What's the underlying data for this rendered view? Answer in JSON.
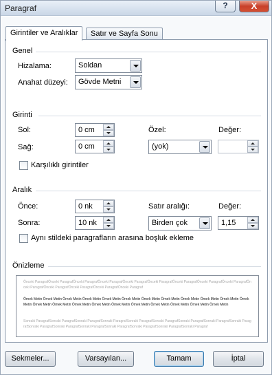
{
  "window": {
    "title": "Paragraf",
    "help_symbol": "?",
    "close_symbol": "X"
  },
  "tabs": [
    {
      "label": "Girintiler ve Aralıklar",
      "active": true
    },
    {
      "label": "Satır ve Sayfa Sonu",
      "active": false
    }
  ],
  "general": {
    "title": "Genel",
    "alignment_label": "Hizalama:",
    "alignment_value": "Soldan",
    "outline_label": "Anahat düzeyi:",
    "outline_value": "Gövde Metni"
  },
  "indent": {
    "title": "Girinti",
    "left_label": "Sol:",
    "left_value": "0 cm",
    "right_label": "Sağ:",
    "right_value": "0 cm",
    "special_label": "Özel:",
    "special_value": "(yok)",
    "by_label": "Değer:",
    "by_value": "",
    "mirror_label": "Karşılıklı girintiler",
    "mirror_checked": false
  },
  "spacing": {
    "title": "Aralık",
    "before_label": "Önce:",
    "before_value": "0 nk",
    "after_label": "Sonra:",
    "after_value": "10 nk",
    "line_label": "Satır aralığı:",
    "line_value": "Birden çok",
    "at_label": "Değer:",
    "at_value": "1,15",
    "no_space_label": "Aynı stildeki paragrafların arasına boşluk ekleme",
    "no_space_checked": false
  },
  "preview": {
    "title": "Önizleme",
    "previous_text": "Önceki ParagrafÖnceki ParagrafÖnceki ParagrafÖnceki ParagrafÖnceki ParagrafÖnceki ParagrafÖnceki ParagrafÖnceki ParagrafÖnceki ParagrafÖnceki ParagrafÖnceki ParagrafÖnceki ParagrafÖnceki ParagrafÖnceki Paragraf",
    "sample_text": "Örnek Metin Örnek Metin Örnek Metin Örnek Metin Örnek Metin Örnek Metin Örnek Metin Örnek Metin Örnek Metin Örnek Metin Örnek Metin Örnek Metin Örnek Metin Örnek Metin Örnek Metin Örnek Metin Örnek Metin Örnek Metin Örnek Metin Örnek Metin Örnek Metin Örnek Metin",
    "following_text": "Sonraki ParagrafSonraki ParagrafSonraki ParagrafSonraki ParagrafSonraki ParagrafSonraki ParagrafSonraki ParagrafSonraki ParagrafSonraki ParagrafSonraki ParagrafSonraki ParagrafSonraki ParagrafSonraki ParagrafSonraki ParagrafSonraki ParagrafSonraki Paragraf"
  },
  "buttons": {
    "tabs": "Sekmeler...",
    "default": "Varsayılan...",
    "ok": "Tamam",
    "cancel": "İptal"
  },
  "colors": {
    "accent": "#3d7bad",
    "titlebar": "#d6e1ee",
    "close": "#c8402a",
    "panel_border": "#8e9cae"
  }
}
